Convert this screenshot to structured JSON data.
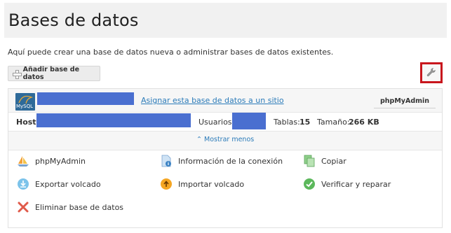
{
  "page": {
    "title": "Bases de datos"
  },
  "intro": {
    "text": "Aquí puede crear una base de datos nueva o administrar bases de datos existentes."
  },
  "toolbar": {
    "add_label": "Añadir base de datos",
    "settings_icon": "wrench-icon"
  },
  "database": {
    "logo_text": "MySQL",
    "assign_link": "Asignar esta base de datos a un sitio",
    "pma_button": "phpMyAdmin",
    "host_label": "Host:",
    "users_label": "Usuarios:",
    "tables_label": "Tablas:",
    "tables_value": "15",
    "size_label": "Tamaño:",
    "size_value": "266 KB",
    "toggle_label": "Mostrar menos"
  },
  "actions": [
    {
      "label": "phpMyAdmin",
      "icon": "sailboat-icon"
    },
    {
      "label": "Información de la conexión",
      "icon": "info-document-icon"
    },
    {
      "label": "Copiar",
      "icon": "copy-icon"
    },
    {
      "label": "Exportar volcado",
      "icon": "download-icon"
    },
    {
      "label": "Importar volcado",
      "icon": "upload-icon"
    },
    {
      "label": "Verificar y reparar",
      "icon": "check-icon"
    },
    {
      "label": "Eliminar base de datos",
      "icon": "delete-icon"
    }
  ],
  "colors": {
    "link": "#2b7bb9",
    "highlight_border": "#c8161d",
    "redaction": "#4a6fd0"
  }
}
